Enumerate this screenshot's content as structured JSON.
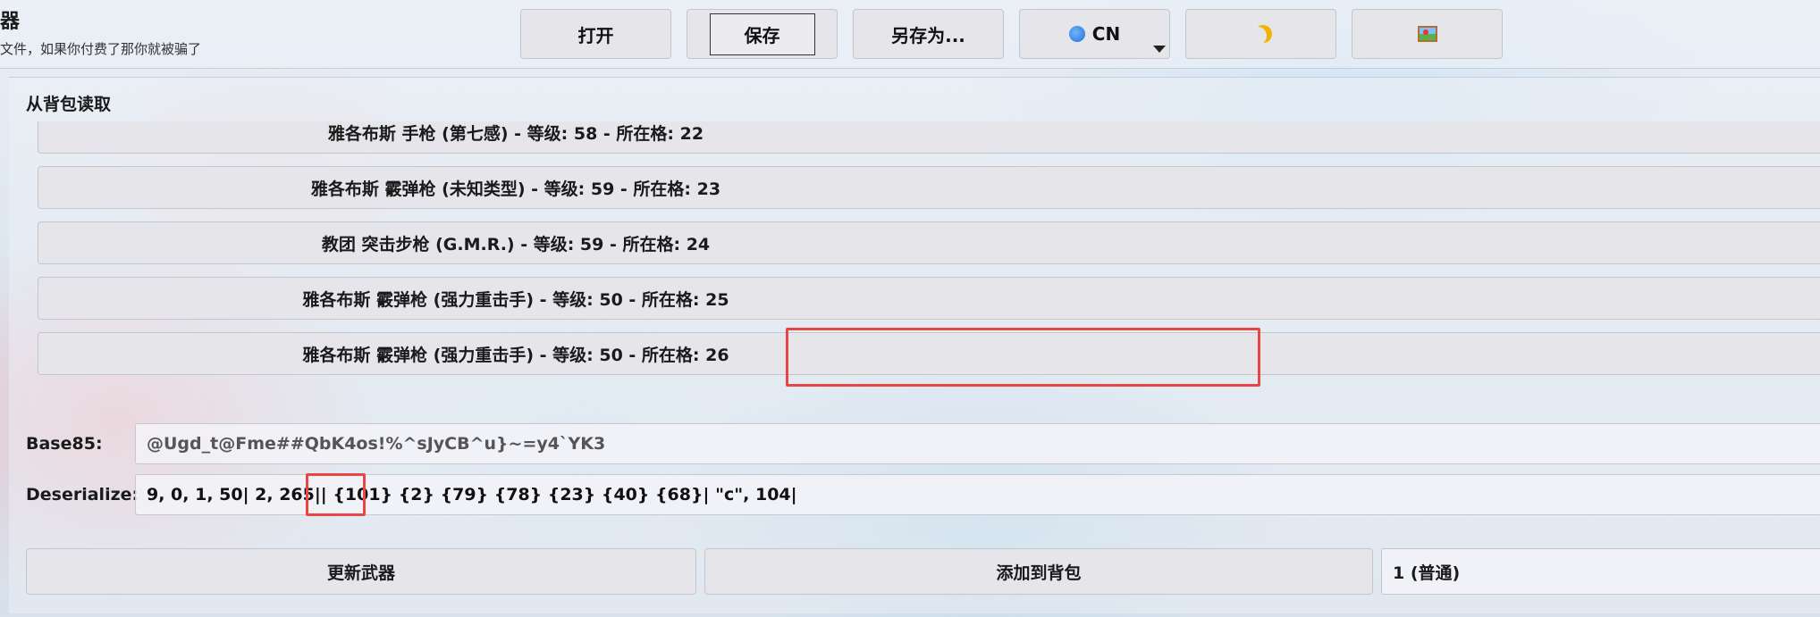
{
  "header": {
    "title": "器",
    "subtitle": "文件，如果你付费了那你就被骗了"
  },
  "toolbar": {
    "open_label": "打开",
    "save_label": "保存",
    "save_as_label": "另存为...",
    "lang_label": "CN",
    "theme_icon": "moon-icon",
    "image_icon": "picture-icon"
  },
  "backpack": {
    "section_label": "从背包读取",
    "items": [
      {
        "label": "雅各布斯 手枪 (第七感) - 等级: 58 - 所在格: 22"
      },
      {
        "label": "雅各布斯 霰弹枪 (未知类型) - 等级: 59 - 所在格: 23"
      },
      {
        "label": "教团 突击步枪 (G.M.R.) - 等级: 59 - 所在格: 24"
      },
      {
        "label": "雅各布斯 霰弹枪 (强力重击手) - 等级: 50 - 所在格: 25"
      },
      {
        "label": "雅各布斯 霰弹枪 (强力重击手) - 等级: 50 - 所在格: 26"
      }
    ]
  },
  "fields": {
    "base85_label": "Base85:",
    "base85_value": "@Ugd_t@Fme##QbK4os!%^sJyCB^u}~=y4`YK3",
    "deserialize_label": "Deserialize:",
    "deserialize_part1": "9, 0, 1, 50| 2, 265|| ",
    "deserialize_highlight": "{101}",
    "deserialize_part2": " {2} {79} {78} {23} {40} {68}| \"c\", 104|"
  },
  "actions": {
    "update_label": "更新武器",
    "add_label": "添加到背包",
    "rarity_value": "1 (普通)"
  },
  "colors": {
    "highlight": "#e84545",
    "button_bg": "#e5e5ea"
  }
}
